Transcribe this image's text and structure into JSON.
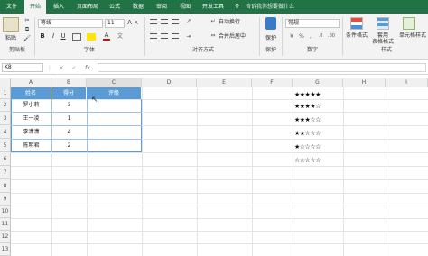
{
  "tabs": [
    "文件",
    "开始",
    "插入",
    "页面布局",
    "公式",
    "数据",
    "审阅",
    "视图",
    "开发工具"
  ],
  "tell_me": "告诉我你想要做什么",
  "ribbon": {
    "paste": "粘贴",
    "cut": "✂",
    "copy": "⧉",
    "format_painter": "🖌",
    "font_name": "等线",
    "font_size": "11",
    "bold": "B",
    "italic": "I",
    "underline": "U",
    "grow": "A",
    "shrink": "A",
    "wrap_text": "自动换行",
    "merge_center": "合并后居中",
    "number_format": "常规",
    "protect": "保护",
    "conditional_format": "条件格式",
    "format_table": "套用\n表格格式",
    "cell_styles": "单元格样式",
    "groups": {
      "clipboard": "剪贴板",
      "font": "字体",
      "alignment": "对齐方式",
      "protect": "保护",
      "number": "数字",
      "styles": "样式"
    }
  },
  "formula_bar": {
    "name_box": "K8",
    "cancel": "✕",
    "enter": "✓",
    "fx": "fx",
    "value": ""
  },
  "columns": [
    "A",
    "B",
    "C",
    "D",
    "E",
    "F",
    "G",
    "H",
    "I"
  ],
  "rows": [
    "1",
    "2",
    "3",
    "4",
    "5",
    "6",
    "7",
    "8",
    "9",
    "10",
    "11",
    "12",
    "13",
    "14",
    "15"
  ],
  "table": {
    "headers": [
      "姓名",
      "得分",
      "评级"
    ],
    "rows": [
      {
        "name": "罗小莉",
        "score": "3",
        "rating": ""
      },
      {
        "name": "王一凌",
        "score": "1",
        "rating": ""
      },
      {
        "name": "李潇潇",
        "score": "4",
        "rating": ""
      },
      {
        "name": "陈明君",
        "score": "2",
        "rating": ""
      }
    ]
  },
  "star_column": [
    "★★★★★",
    "★★★★☆",
    "★★★☆☆",
    "★★☆☆☆",
    "★☆☆☆☆",
    "☆☆☆☆☆"
  ]
}
